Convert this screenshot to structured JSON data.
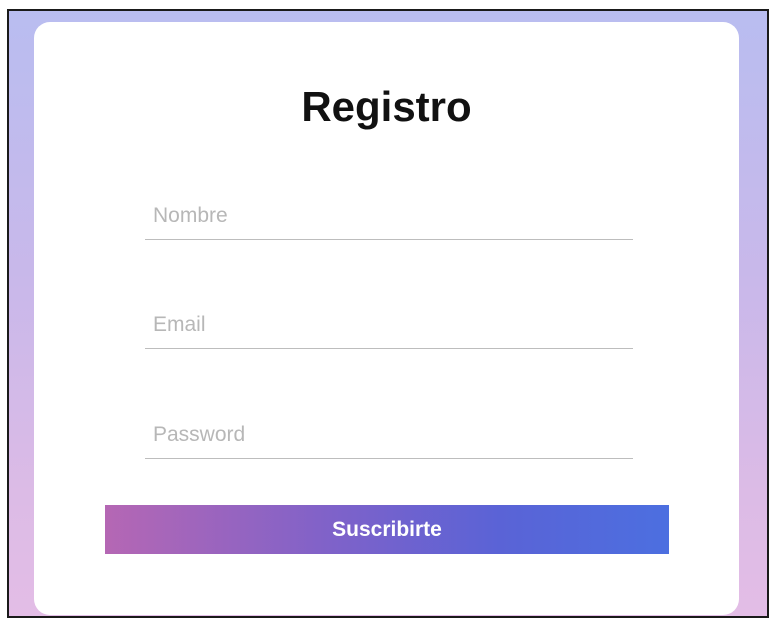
{
  "form": {
    "title": "Registro",
    "fields": {
      "nombre": {
        "placeholder": "Nombre",
        "value": ""
      },
      "email": {
        "placeholder": "Email",
        "value": ""
      },
      "password": {
        "placeholder": "Password",
        "value": ""
      }
    },
    "submit_label": "Suscribirte"
  },
  "colors": {
    "button_gradient_start": "#b567b4",
    "button_gradient_end": "#4c6fe0",
    "background_top": "#b9bdf0",
    "background_bottom": "#e3bde6"
  }
}
